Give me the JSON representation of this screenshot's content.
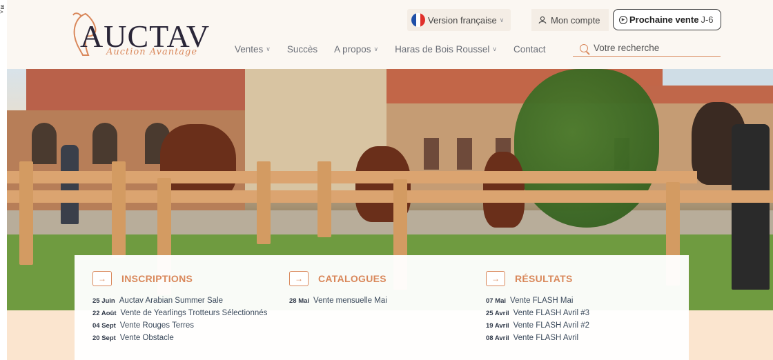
{
  "edge_marker": "≦ >",
  "header": {
    "logo": {
      "name": "AUCTAV",
      "tagline": "Auction Avantage"
    },
    "language": {
      "label": "Version française",
      "flag_colors": [
        "#1f4fa8",
        "#ffffff",
        "#e0302b"
      ]
    },
    "account": {
      "label": "Mon compte"
    },
    "next_sale": {
      "label": "Prochaine vente",
      "countdown": "J-6"
    },
    "nav": [
      {
        "label": "Ventes",
        "dropdown": true
      },
      {
        "label": "Succès",
        "dropdown": false
      },
      {
        "label": "A propos",
        "dropdown": true
      },
      {
        "label": "Haras de Bois Roussel",
        "dropdown": true
      },
      {
        "label": "Contact",
        "dropdown": false
      }
    ],
    "search": {
      "placeholder": "Votre recherche"
    }
  },
  "hero": {
    "image": "horses-at-stables-photo"
  },
  "sections": {
    "inscriptions": {
      "title": "INSCRIPTIONS",
      "items": [
        {
          "date": "25 Juin",
          "label": "Auctav Arabian Summer Sale"
        },
        {
          "date": "22 Août",
          "label": "Vente de Yearlings Trotteurs Sélectionnés"
        },
        {
          "date": "04 Sept",
          "label": "Vente Rouges Terres"
        },
        {
          "date": "20 Sept",
          "label": "Vente Obstacle"
        }
      ]
    },
    "catalogues": {
      "title": "CATALOGUES",
      "items": [
        {
          "date": "28 Mai",
          "label": "Vente mensuelle Mai"
        }
      ]
    },
    "resultats": {
      "title": "RÉSULTATS",
      "items": [
        {
          "date": "07 Mai",
          "label": "Vente FLASH Mai"
        },
        {
          "date": "25 Avril",
          "label": "Vente FLASH Avril #3"
        },
        {
          "date": "19 Avril",
          "label": "Vente FLASH Avril #2"
        },
        {
          "date": "08 Avril",
          "label": "Vente FLASH Avril"
        }
      ]
    }
  },
  "colors": {
    "accent": "#d9875a",
    "header_bg": "#fbf7f2",
    "lower_band": "#fbe5cf"
  }
}
